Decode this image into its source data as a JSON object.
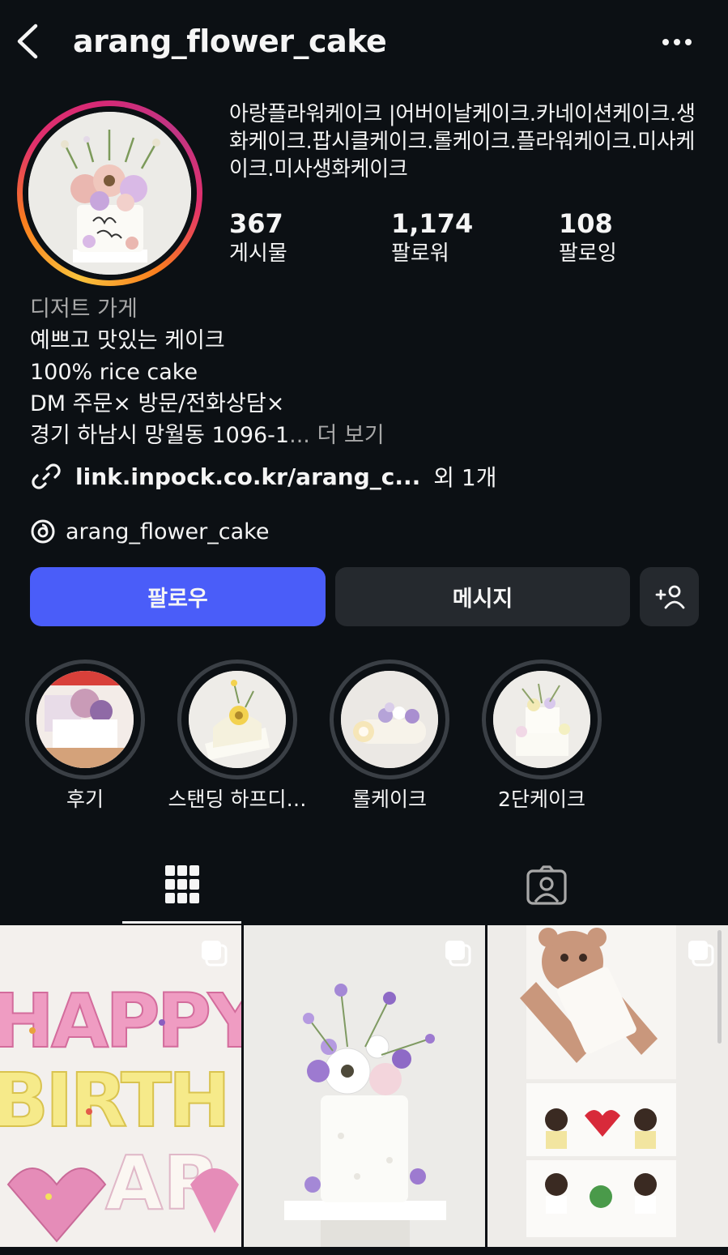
{
  "header": {
    "username": "arang_flower_cake",
    "back_icon": "chevron-left-icon",
    "more_icon": "more-horizontal-icon"
  },
  "profile": {
    "display_name": "아랑플라워케이크 |어버이날케이크.카네이션케이크.생화케이크.팝시클케이크.롤케이크.플라워케이크.미사케이크.미사생화케이크",
    "stats": [
      {
        "value": "367",
        "label": "게시물"
      },
      {
        "value": "1,174",
        "label": "팔로워"
      },
      {
        "value": "108",
        "label": "팔로잉"
      }
    ],
    "category": "디저트 가게",
    "bio_lines": [
      "예쁘고 맛있는 케이크",
      "100% rice cake",
      "DM 주문× 방문/전화상담×"
    ],
    "address": "경기 하남시 망월동 1096-1",
    "ellipsis": "...",
    "more_label": "더 보기",
    "link_text": "link.inpock.co.kr/arang_c...",
    "link_extra": "외 1개",
    "threads_handle": "arang_flower_cake"
  },
  "actions": {
    "follow_label": "팔로우",
    "message_label": "메시지",
    "add_user_icon": "add-person-icon"
  },
  "highlights": [
    {
      "label": "후기"
    },
    {
      "label": "스탠딩 하프디…"
    },
    {
      "label": "롤케이크"
    },
    {
      "label": "2단케이크"
    }
  ],
  "tabs": [
    {
      "name": "grid",
      "icon": "grid-icon",
      "active": true
    },
    {
      "name": "tagged",
      "icon": "tagged-person-icon",
      "active": false
    }
  ],
  "colors": {
    "background": "#0c1014",
    "follow_button": "#4a5df9",
    "secondary_button": "#25292e",
    "muted_text": "#a8a8a8"
  }
}
